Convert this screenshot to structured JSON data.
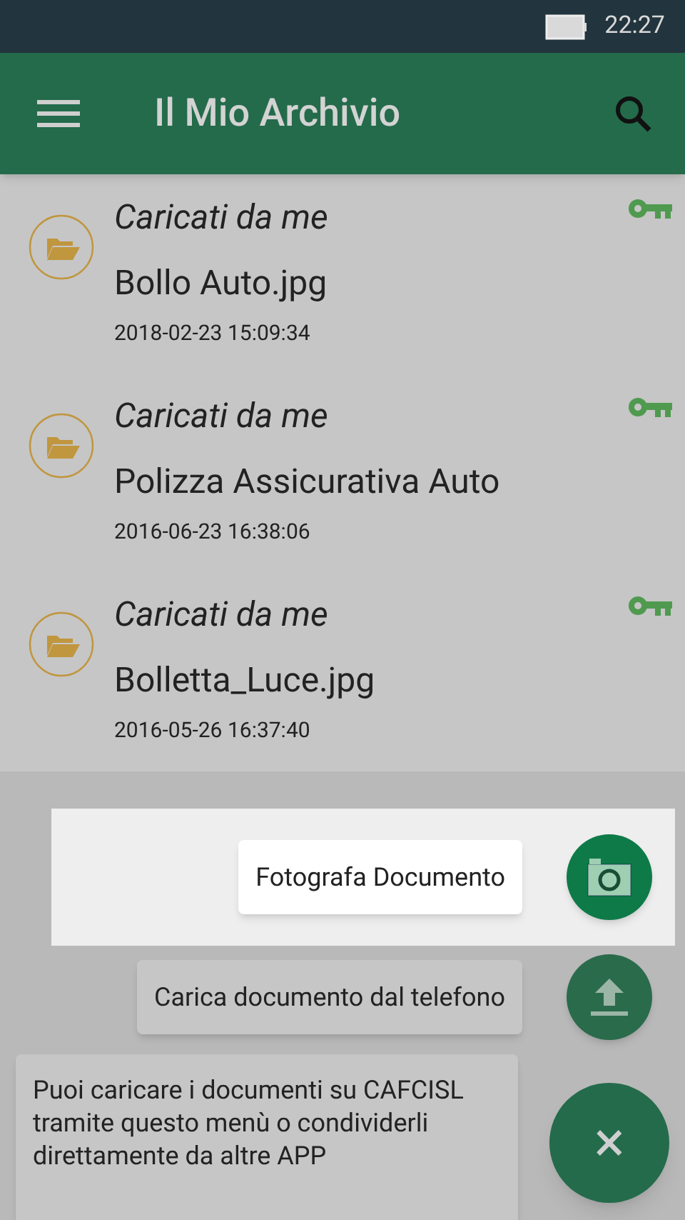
{
  "status_bar": {
    "time": "22:27"
  },
  "app_bar": {
    "title": "Il Mio Archivio"
  },
  "files": [
    {
      "source": "Caricati da me",
      "name": "Bollo Auto.jpg",
      "date": "2018-02-23 15:09:34"
    },
    {
      "source": "Caricati da me",
      "name": "Polizza Assicurativa Auto",
      "date": "2016-06-23 16:38:06"
    },
    {
      "source": "Caricati da me",
      "name": "Bolletta_Luce.jpg",
      "date": "2016-05-26 16:37:40"
    }
  ],
  "fab_actions": [
    {
      "kind": "camera",
      "label": "Fotografa Documento",
      "selected": true
    },
    {
      "kind": "upload",
      "label": "Carica documento dal telefono",
      "selected": false
    }
  ],
  "hint": "Puoi caricare i documenti su CAFCISL tramite questo menù o condividerli direttamente da altre APP",
  "close_fab": {
    "symbol": "×"
  }
}
